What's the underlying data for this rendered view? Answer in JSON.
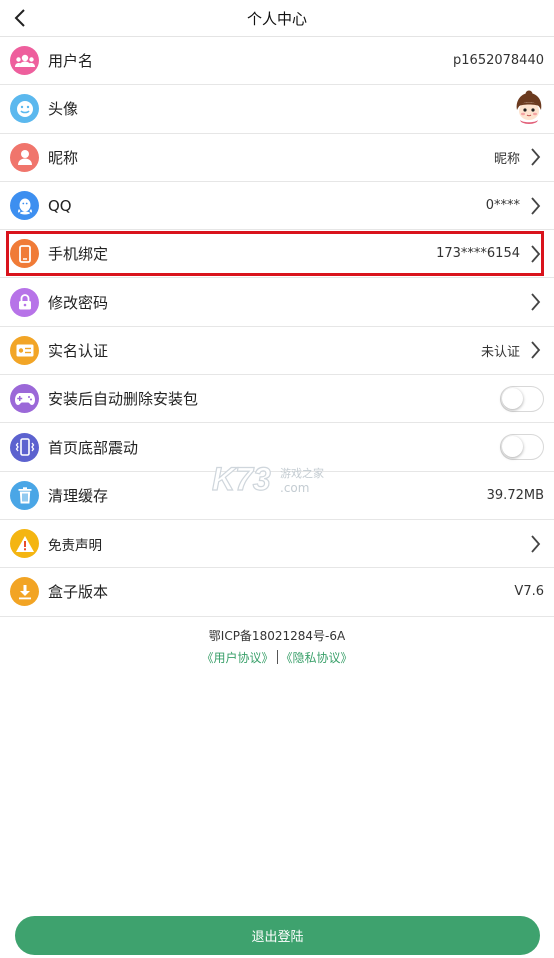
{
  "header": {
    "title": "个人中心"
  },
  "rows": [
    {
      "label": "用户名",
      "value": "p1652078440",
      "icon": "users-icon",
      "color": "#ee5f9d"
    },
    {
      "label": "头像",
      "value": "",
      "icon": "smile-icon",
      "color": "#5bb8ee"
    },
    {
      "label": "昵称",
      "value": "昵称",
      "icon": "person-icon",
      "color": "#f0756c"
    },
    {
      "label": "QQ",
      "value": "0****",
      "icon": "qq-icon",
      "color": "#3d8ff0"
    },
    {
      "label": "手机绑定",
      "value": "173****6154",
      "icon": "phone-icon",
      "color": "#f07b37"
    },
    {
      "label": "修改密码",
      "value": "",
      "icon": "lock-icon",
      "color": "#b773e8"
    },
    {
      "label": "实名认证",
      "value": "未认证",
      "icon": "id-card-icon",
      "color": "#f2a526"
    },
    {
      "label": "安装后自动删除安装包",
      "value": "",
      "icon": "gamepad-icon",
      "color": "#9b68d8"
    },
    {
      "label": "首页底部震动",
      "value": "",
      "icon": "vibrate-icon",
      "color": "#5c62cf"
    },
    {
      "label": "清理缓存",
      "value": "39.72MB",
      "icon": "trash-icon",
      "color": "#4aa6e6"
    },
    {
      "label": "免责声明",
      "value": "",
      "icon": "warning-icon",
      "color": "#f4b511"
    },
    {
      "label": "盒子版本",
      "value": "V7.6",
      "icon": "download-icon",
      "color": "#f2a424"
    }
  ],
  "footer": {
    "icp": "鄂ICP备18021284号-6A",
    "user_agreement": "《用户协议》",
    "privacy_agreement": "《隐私协议》"
  },
  "watermark": {
    "brand": "K73",
    "text": "游戏之家",
    "domain": ".com"
  },
  "logout": {
    "label": "退出登陆"
  },
  "colors": {
    "accent": "#3ea26e",
    "highlight": "#d9131c"
  }
}
